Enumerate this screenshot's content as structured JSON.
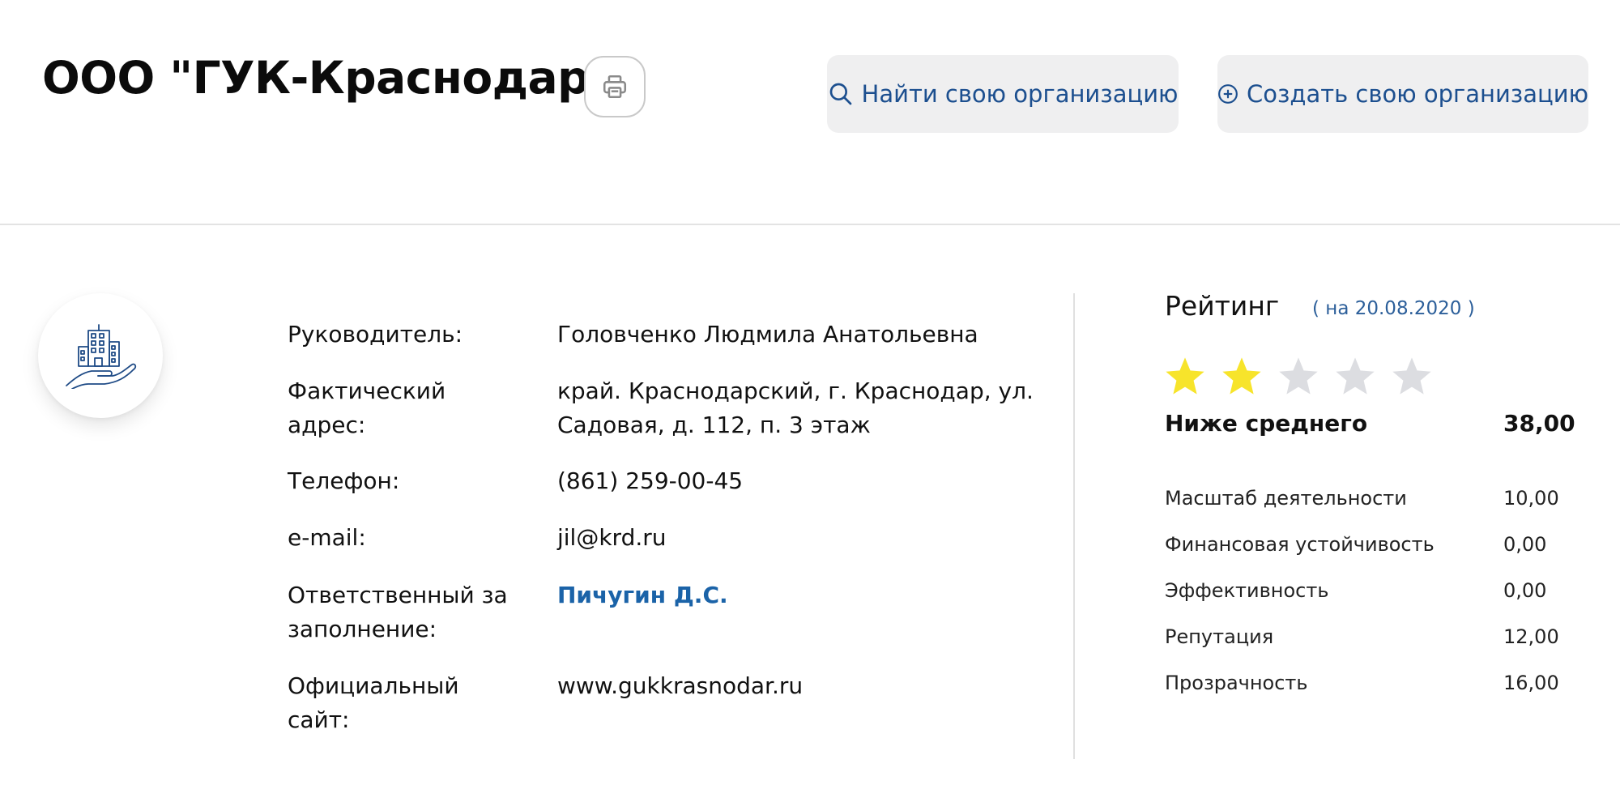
{
  "header": {
    "title": "ООО \"ГУК-Краснодар\"",
    "find_label": "Найти свою организацию",
    "create_label": "Создать свою организацию"
  },
  "details": [
    {
      "label": "Руководитель:",
      "value": "Головченко Людмила Анатольевна"
    },
    {
      "label": "Фактический адрес:",
      "value": "край. Краснодарский, г. Краснодар, ул. Садовая, д. 112, п. 3 этаж"
    },
    {
      "label": "Телефон:",
      "value": "(861) 259-00-45"
    },
    {
      "label": "e-mail:",
      "value": "jil@krd.ru"
    },
    {
      "label": "Ответственный за заполнение:",
      "value": "Пичугин Д.С."
    },
    {
      "label": "Официальный сайт:",
      "value": "www.gukkrasnodar.ru"
    }
  ],
  "rating": {
    "title": "Рейтинг",
    "date": "( на 20.08.2020 )",
    "stars_filled": 2,
    "stars_total": 5,
    "level": "Ниже среднего",
    "score": "38,00",
    "metrics": [
      {
        "name": "Масштаб деятельности",
        "value": "10,00"
      },
      {
        "name": "Финансовая устойчивость",
        "value": "0,00"
      },
      {
        "name": "Эффективность",
        "value": "0,00"
      },
      {
        "name": "Репутация",
        "value": "12,00"
      },
      {
        "name": "Прозрачность",
        "value": "16,00"
      }
    ]
  },
  "colors": {
    "accent": "#1c4f8f",
    "link": "#1b63a8",
    "star_filled": "#f7e42b",
    "star_empty": "#dcdde1",
    "button_bg": "#efeff0"
  },
  "icons": {
    "print": "printer-icon",
    "find": "search-icon",
    "create": "plus-circle-icon",
    "logo": "building-in-hand-icon"
  }
}
